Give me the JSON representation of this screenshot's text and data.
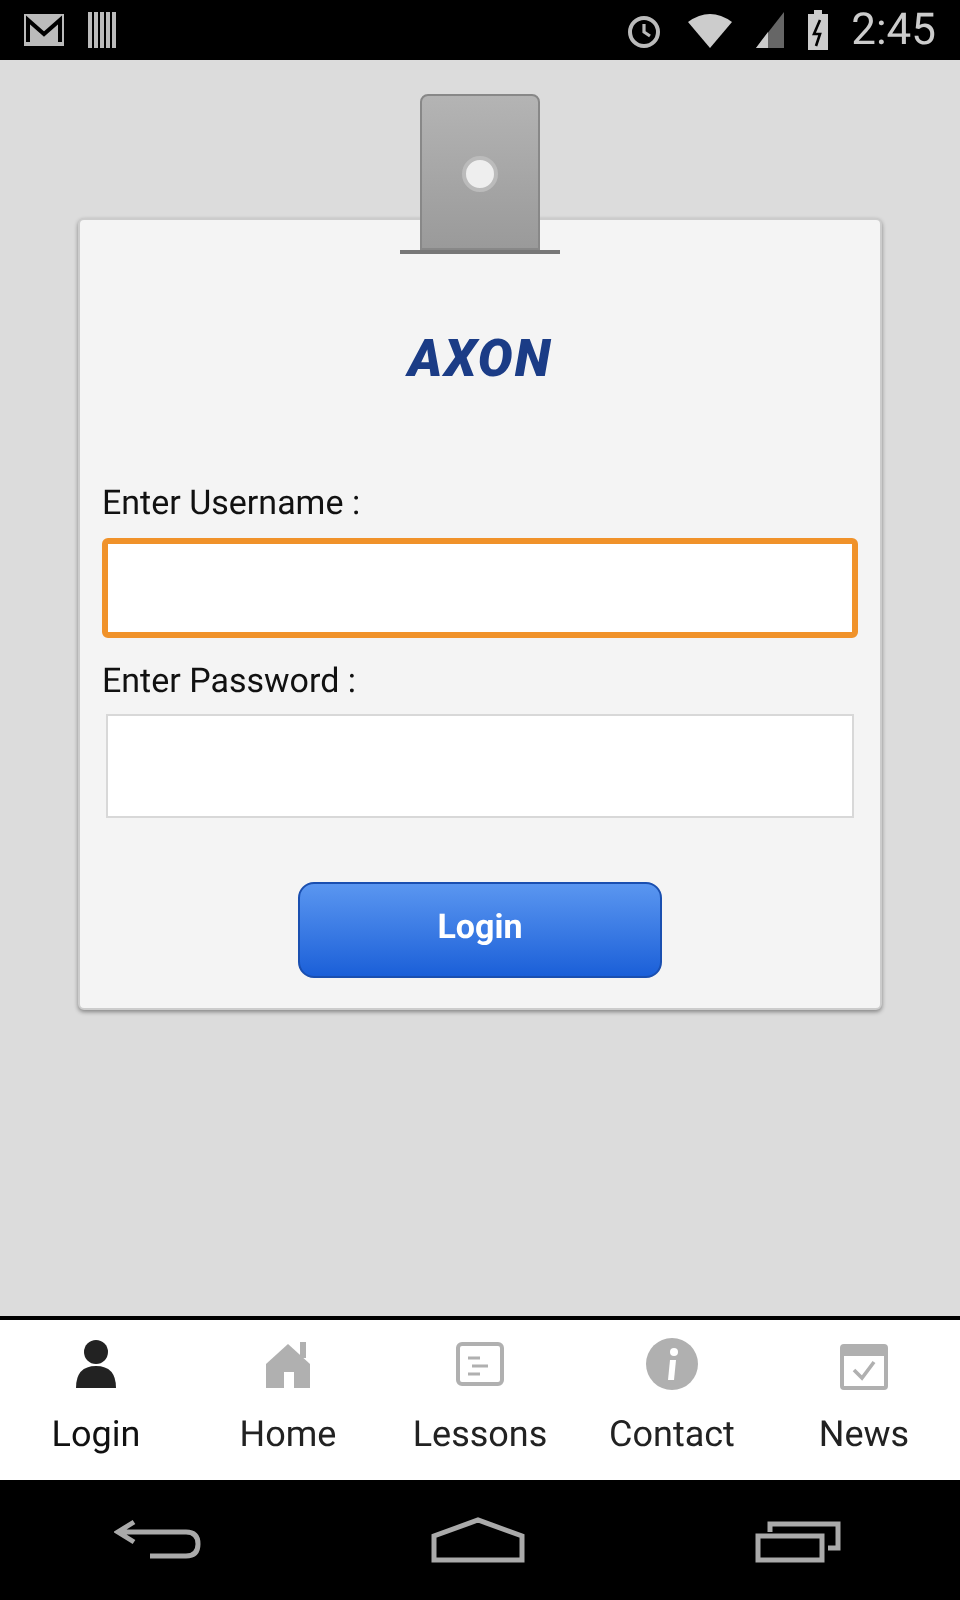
{
  "status_bar": {
    "time": "2:45"
  },
  "logo": {
    "text": "AXON"
  },
  "form": {
    "fields": [
      {
        "label": "Enter Username :",
        "focused": true
      },
      {
        "label": "Enter Password :",
        "focused": false
      }
    ],
    "button": "Login"
  },
  "tabs": [
    {
      "label": "Login",
      "selected": true
    },
    {
      "label": "Home",
      "selected": false
    },
    {
      "label": "Lessons",
      "selected": false
    },
    {
      "label": "Contact",
      "selected": false
    },
    {
      "label": "News",
      "selected": false
    }
  ]
}
